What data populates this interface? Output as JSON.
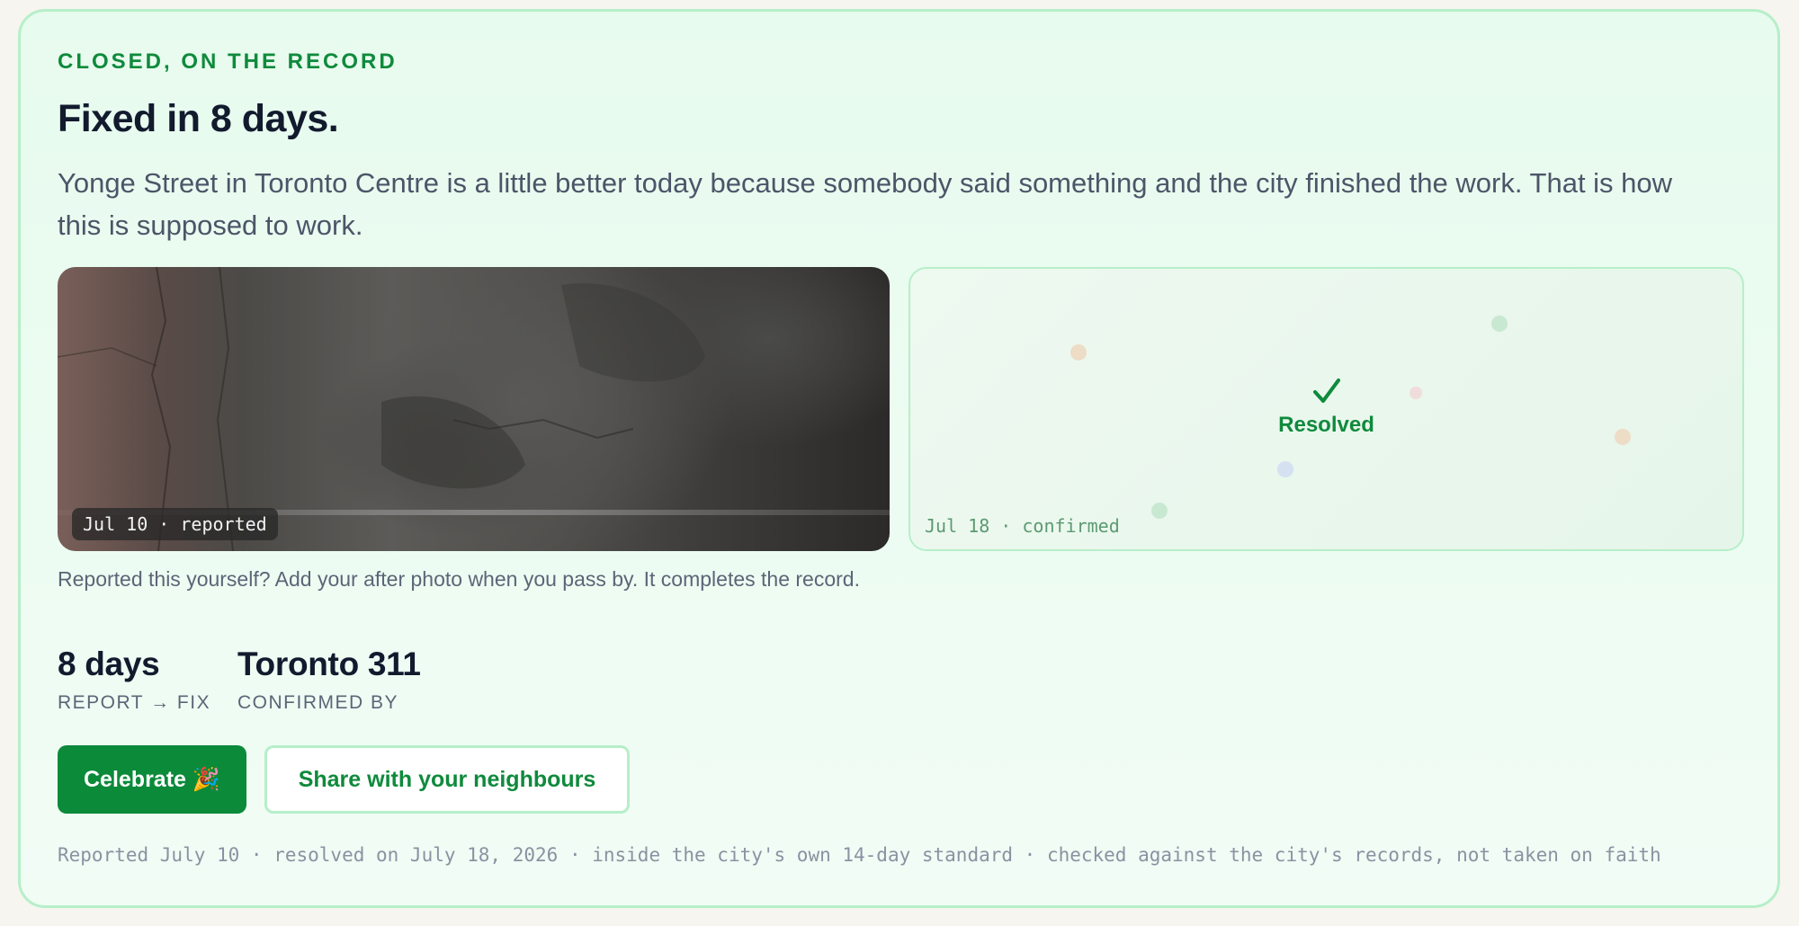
{
  "card": {
    "eyebrow": "CLOSED, ON THE RECORD",
    "title": "Fixed in 8 days.",
    "lead": "Yonge Street in Toronto Centre is a little better today because somebody said something and the city finished the work. That is how this is supposed to work."
  },
  "photos": {
    "before_stamp": "Jul 10 · reported",
    "after_stamp": "Jul 18 · confirmed",
    "after_status": "Resolved",
    "after_icon": "checkmark-icon"
  },
  "hint": "Reported this yourself? Add your after photo when you pass by. It completes the record.",
  "stats": [
    {
      "value": "8 days",
      "label": "REPORT → FIX"
    },
    {
      "value": "Toronto 311",
      "label": "CONFIRMED BY"
    }
  ],
  "actions": {
    "celebrate": "Celebrate 🎉",
    "share": "Share with your neighbours"
  },
  "footnote": "Reported July 10 · resolved on July 18, 2026 · inside the city's own 14-day standard · checked against the city's records, not taken on faith",
  "colors": {
    "accent": "#0f8a3c",
    "card_background": "#e7fbee",
    "card_border": "#b6efc9",
    "heading": "#121a2e"
  }
}
